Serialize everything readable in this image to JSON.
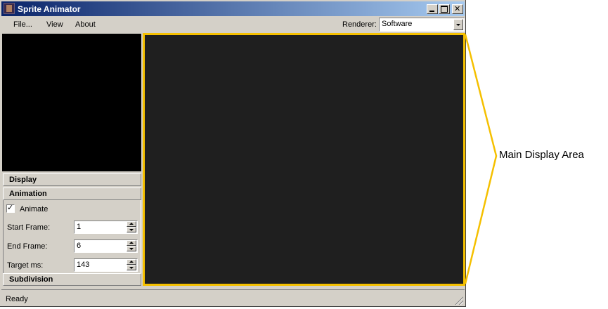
{
  "window": {
    "title": "Sprite Animator"
  },
  "menu": {
    "items": [
      {
        "label": "File..."
      },
      {
        "label": "View"
      },
      {
        "label": "About"
      }
    ],
    "renderer_label": "Renderer:",
    "renderer_value": "Software"
  },
  "panels": {
    "display": "Display",
    "animation": "Animation",
    "subdivision": "Subdivision"
  },
  "animation": {
    "animate_label": "Animate",
    "animate_checked": true,
    "fields": [
      {
        "label": "Start Frame:",
        "value": "1"
      },
      {
        "label": "End Frame:",
        "value": "6"
      },
      {
        "label": "Target ms:",
        "value": "143"
      }
    ]
  },
  "status": {
    "text": "Ready"
  },
  "annotation": {
    "label": "Main Display Area",
    "color": "#f5c000"
  },
  "colors": {
    "highlight": "#f5c000",
    "display_bg": "#1f1f1f",
    "title_gradient_start": "#0a246a",
    "title_gradient_end": "#a6caf0"
  }
}
